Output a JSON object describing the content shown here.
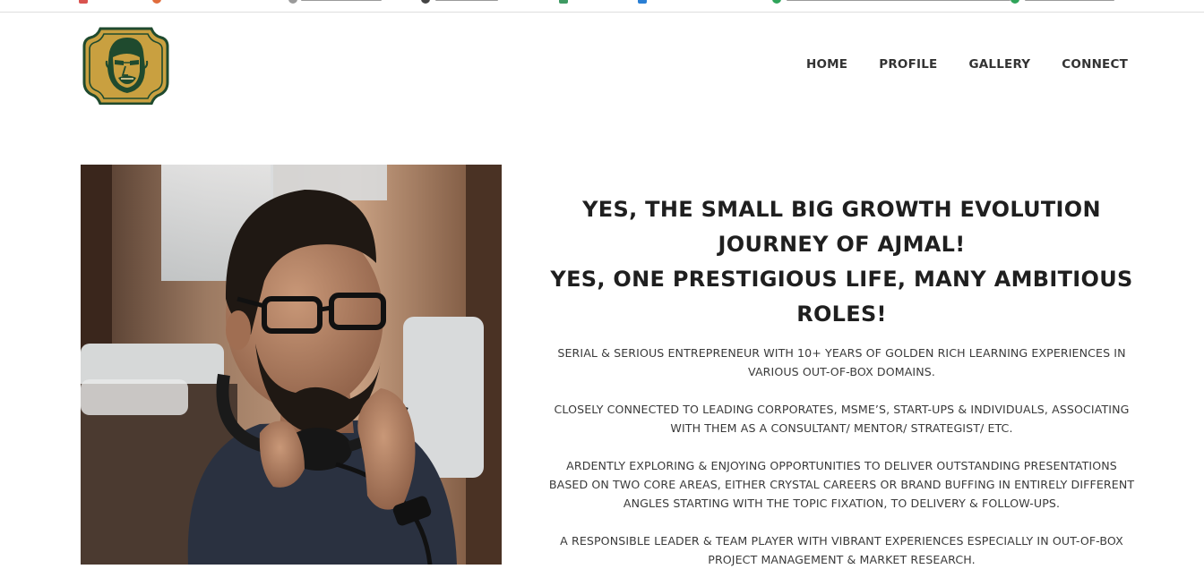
{
  "nav": {
    "items": [
      {
        "label": "HOME"
      },
      {
        "label": "PROFILE"
      },
      {
        "label": "GALLERY"
      },
      {
        "label": "CONNECT"
      }
    ]
  },
  "hero": {
    "headline_line_1": "YES, THE SMALL BIG GROWTH EVOLUTION JOURNEY OF AJMAL!",
    "headline_line_2": "YES, ONE PRESTIGIOUS LIFE, MANY AMBITIOUS ROLES!",
    "paragraphs": [
      "SERIAL & SERIOUS ENTREPRENEUR WITH 10+ YEARS OF GOLDEN RICH LEARNING EXPERIENCES IN VARIOUS OUT-OF-BOX DOMAINS.",
      "CLOSELY CONNECTED TO LEADING CORPORATES, MSME’S, START-UPS & INDIVIDUALS, ASSOCIATING WITH THEM AS A CONSULTANT/ MENTOR/ STRATEGIST/ ETC.",
      "ARDENTLY EXPLORING & ENJOYING OPPORTUNITIES TO DELIVER OUTSTANDING PRESENTATIONS BASED ON TWO CORE AREAS, EITHER CRYSTAL CAREERS OR BRAND BUFFING IN ENTIRELY DIFFERENT ANGLES STARTING WITH THE TOPIC FIXATION, TO DELIVERY & FOLLOW-UPS.",
      "A RESPONSIBLE LEADER & TEAM PLAYER WITH VIBRANT EXPERIENCES ESPECIALLY IN OUT-OF-BOX PROJECT MANAGEMENT & MARKET RESEARCH."
    ]
  },
  "colors": {
    "logo_gold": "#c9a040",
    "logo_green": "#1f4a2e",
    "nav_text": "#333333",
    "headline_text": "#1f1f1f"
  },
  "icons": {
    "logo": "caricature-badge-logo",
    "photo": "man-with-headphones-photo"
  }
}
